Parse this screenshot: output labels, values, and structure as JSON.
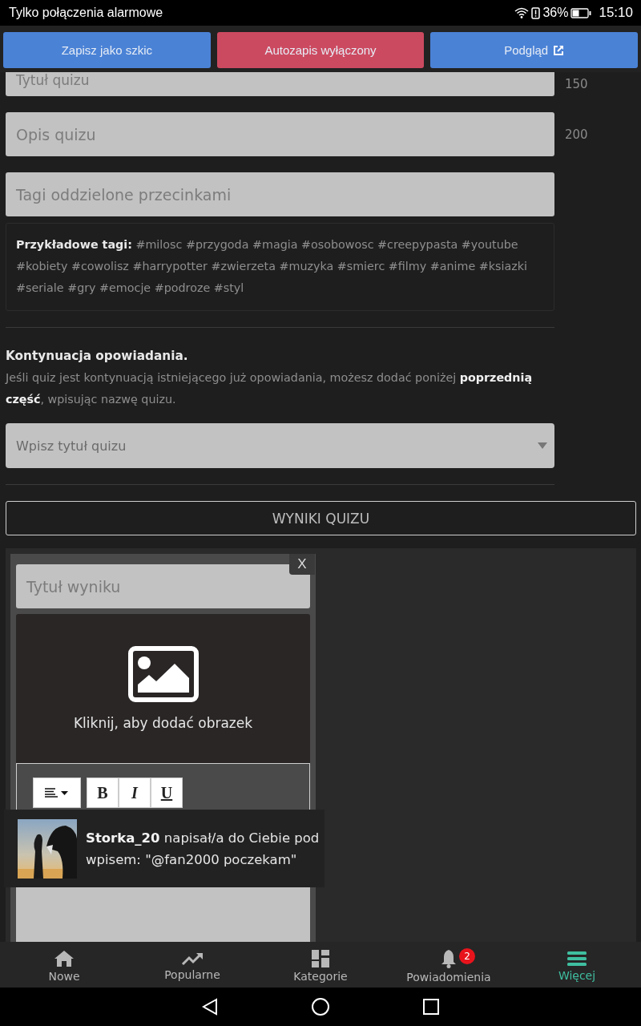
{
  "status_bar": {
    "carrier": "Tylko połączenia alarmowe",
    "battery_percent": "36%",
    "time": "15:10"
  },
  "toolbar": [
    {
      "label": "Zapisz jako szkic",
      "kind": "primary",
      "external": false
    },
    {
      "label": "Autozapis wyłączony",
      "kind": "danger",
      "external": false
    },
    {
      "label": "Podgląd",
      "kind": "primary",
      "external": true
    }
  ],
  "fields": [
    {
      "placeholder": "Tytuł quizu",
      "counter": "150"
    },
    {
      "placeholder": "Opis quizu",
      "counter": "200"
    },
    {
      "placeholder": "Tagi oddzielone przecinkami"
    }
  ],
  "tags_hint": "**Przykładowe tagi:** #milosc #przygoda #magia #osobowosc #creepypasta #youtube #kobiety #cowolisz #harrypotter #zwierzeta #muzyka #smierc #filmy #anime #ksiazki #seriale #gry #emocje #podroze #styl",
  "continuation": {
    "heading": "Kontynuacja opowiadania.",
    "text": "Jeśli quiz jest kontynuacją istniejącego już opowiadania, możesz dodać poniżej **poprzednią część**, wpisując nazwę quizu.",
    "select_placeholder": "Wpisz tytuł quizu"
  },
  "results_button": "WYNIKI QUIZU",
  "result_card": {
    "close": "X",
    "title_placeholder": "Tytuł wyniku",
    "image_prompt": "Kliknij, aby dodać obrazek",
    "format_buttons": [
      "B",
      "I",
      "U"
    ]
  },
  "notification": {
    "text": "**Storka_20** napisał/a do Ciebie pod wpisem: \"@fan2000 poczekam\""
  },
  "bottom_nav": [
    {
      "label": "Nowe",
      "selected": false
    },
    {
      "label": "Popularne",
      "selected": false
    },
    {
      "label": "Kategorie",
      "selected": false
    },
    {
      "label": "Powiadomienia",
      "selected": false,
      "badge": "2"
    },
    {
      "label": "Więcej",
      "selected": true
    }
  ]
}
